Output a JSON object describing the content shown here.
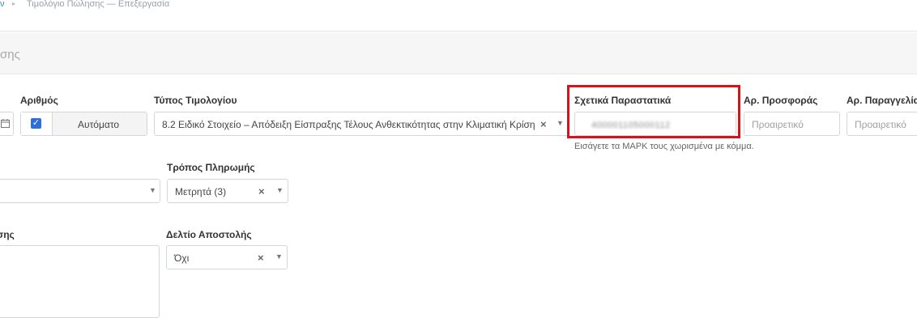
{
  "breadcrumb": {
    "prev": "ν",
    "separator": "▸",
    "current": "Τιμολόγιο Πώλησης — Επεξεργασία"
  },
  "box": {
    "title": "σης"
  },
  "fields": {
    "number": {
      "label": "Αριθμός",
      "auto_label": "Αυτόματο",
      "checked": true
    },
    "invoice_type": {
      "label": "Τύπος Τιμολογίου",
      "value": "8.2 Ειδικό Στοιχείο – Απόδειξη Είσπραξης Τέλους Ανθεκτικότητας στην Κλιματική Κρίση"
    },
    "related_docs": {
      "label": "Σχετικά Παραστατικά",
      "value": "400001105000112",
      "help": "Εισάγετε τα ΜΑΡΚ τους χωρισμένα με κόμμα."
    },
    "offer_no": {
      "label": "Αρ. Προσφοράς",
      "placeholder": "Προαιρετικό"
    },
    "order_no": {
      "label": "Αρ. Παραγγελίας",
      "placeholder": "Προαιρετικό"
    },
    "payment_method": {
      "label": "Τρόπος Πληρωμής",
      "value": "Μετρητά (3)"
    },
    "delivery_note": {
      "label": "Δελτίο Αποστολής",
      "value": "Όχι"
    },
    "notes": {
      "label": "σης"
    }
  },
  "icons": {
    "clear": "×",
    "caret": "▼",
    "calendar": "calendar-icon",
    "check": "✓"
  },
  "colors": {
    "highlight": "#d8121b",
    "checkbox": "#2d6fd6",
    "link": "#3c8dbc"
  }
}
